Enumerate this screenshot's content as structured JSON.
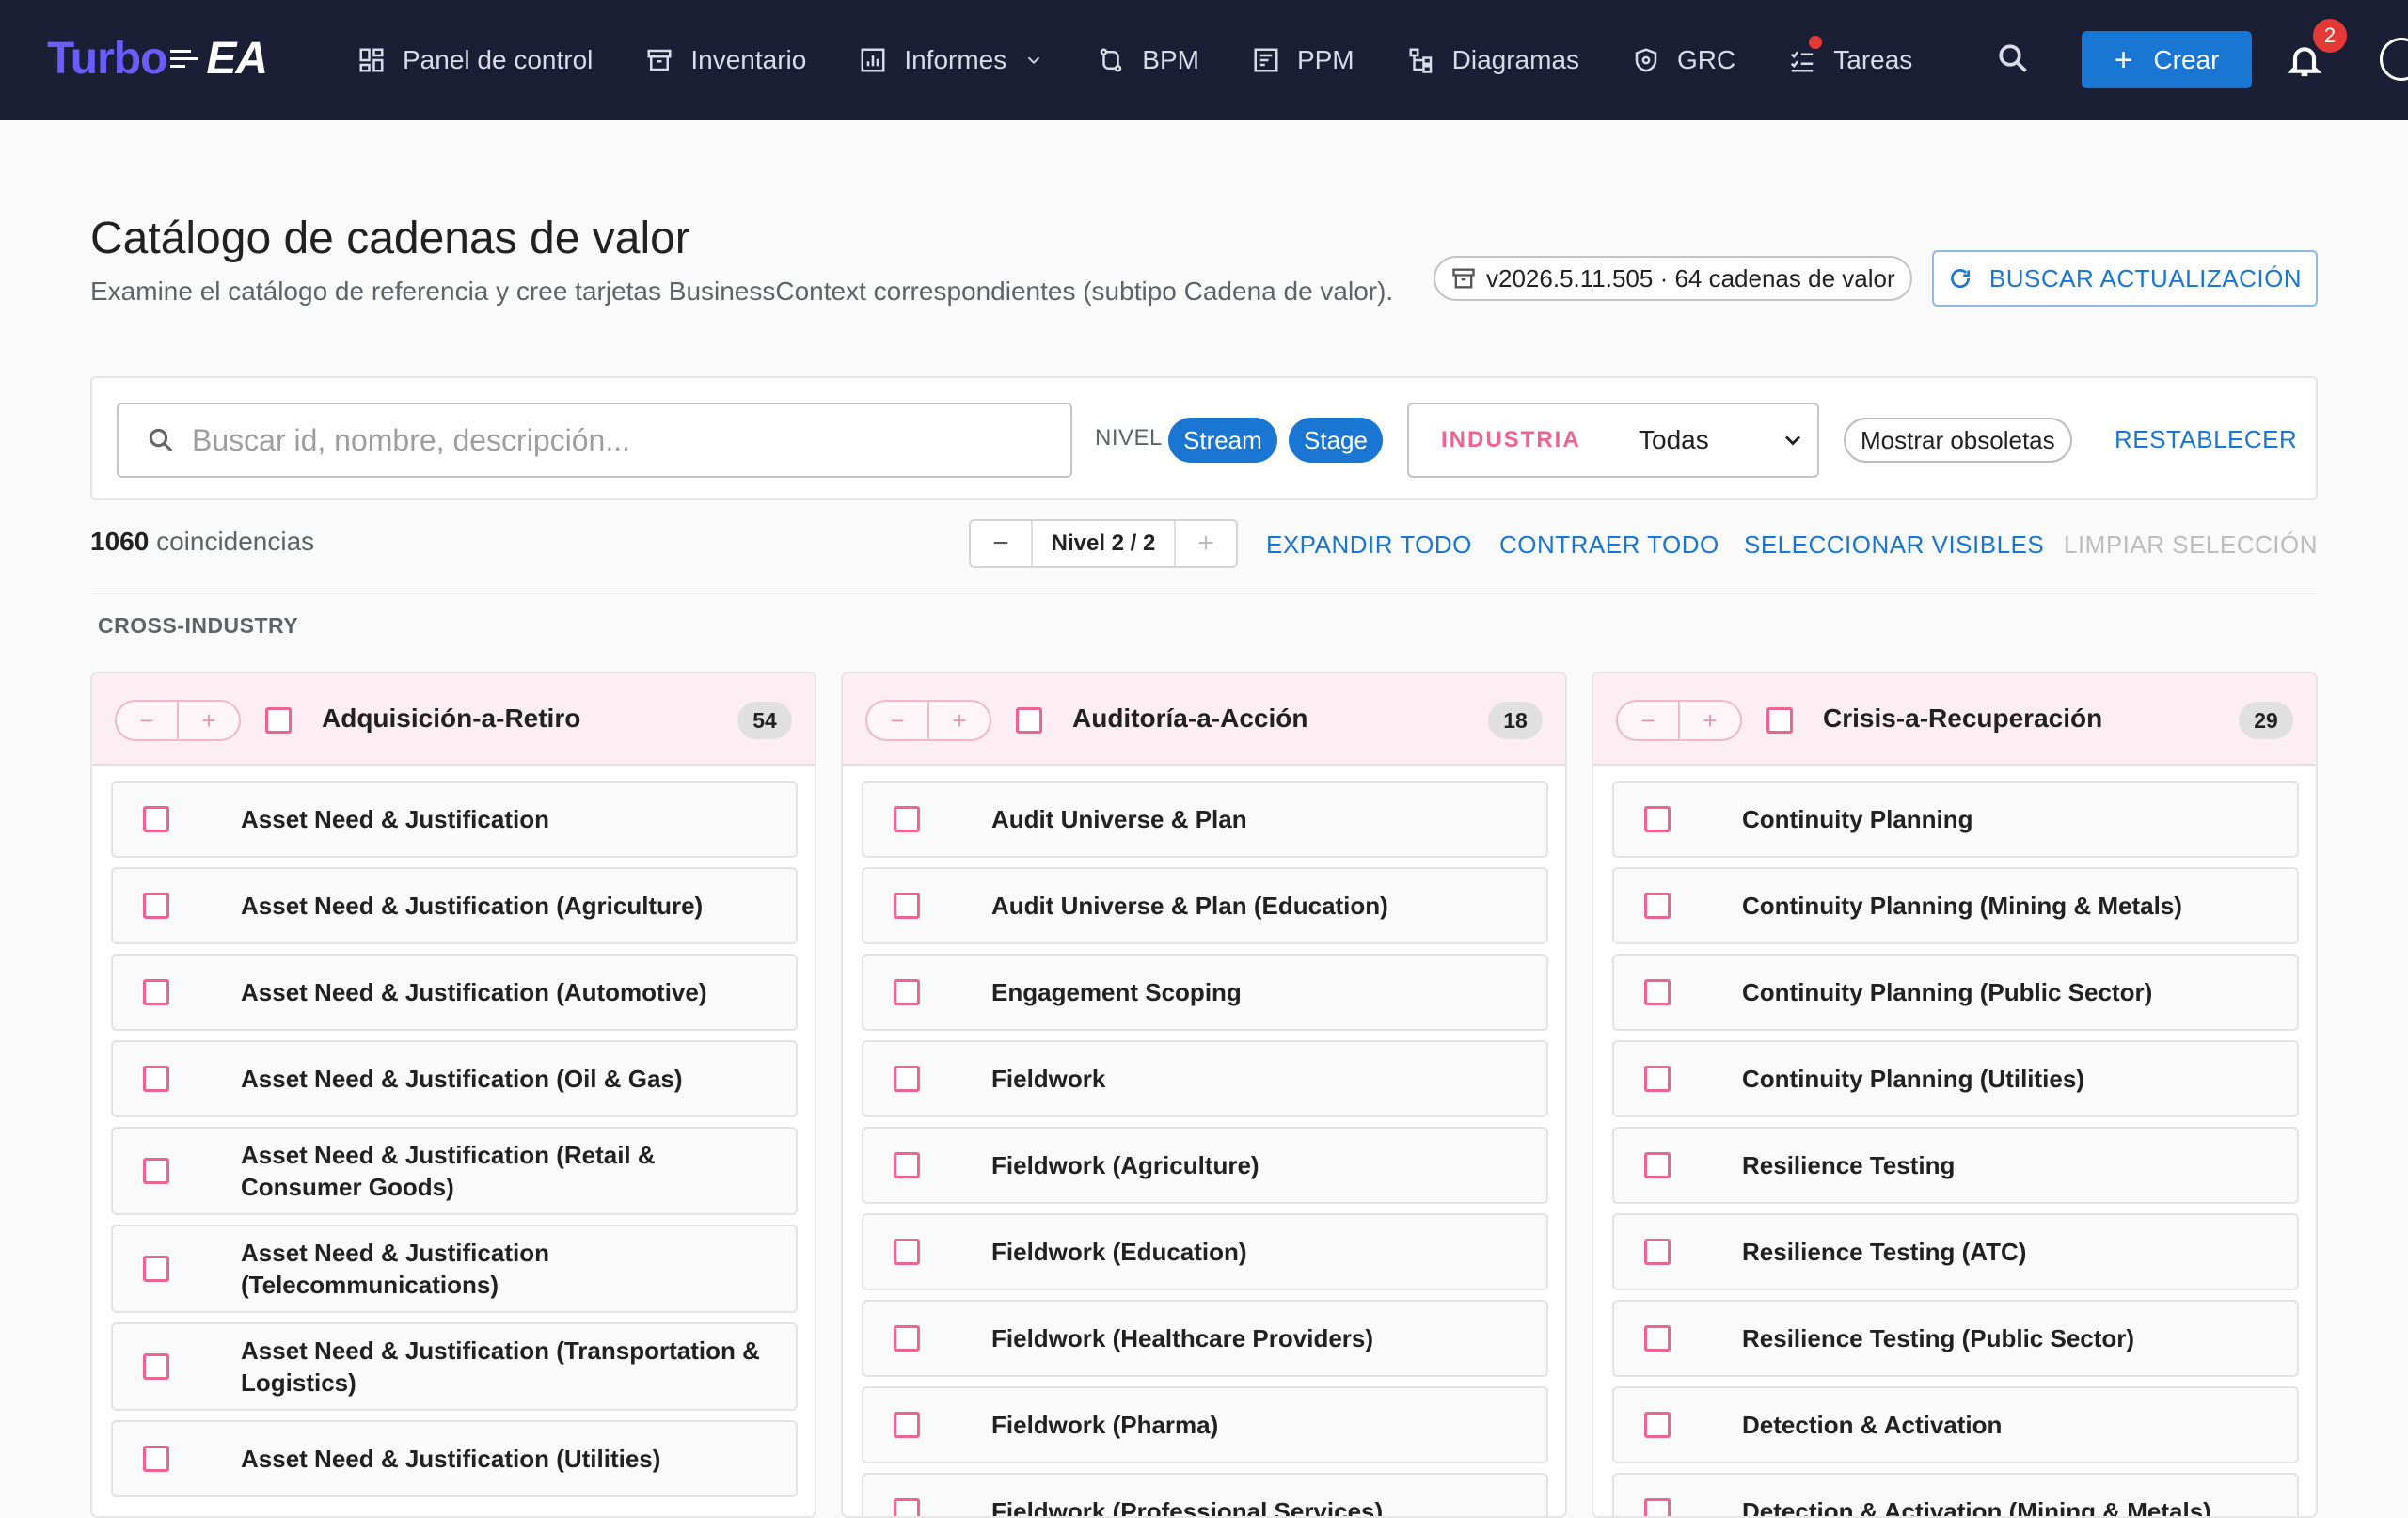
{
  "app": {
    "logo_text": "Turbo",
    "logo_suffix": "EA"
  },
  "nav": [
    {
      "label": "Panel de control",
      "icon": "dashboard-icon"
    },
    {
      "label": "Inventario",
      "icon": "archive-icon"
    },
    {
      "label": "Informes",
      "icon": "report-icon"
    },
    {
      "label": "BPM",
      "icon": "process-icon"
    },
    {
      "label": "PPM",
      "icon": "project-icon"
    },
    {
      "label": "Diagramas",
      "icon": "diagram-icon"
    },
    {
      "label": "GRC",
      "icon": "shield-icon"
    },
    {
      "label": "Tareas",
      "icon": "tasks-icon"
    }
  ],
  "topbar": {
    "create_label": "Crear",
    "notification_count": "2"
  },
  "header": {
    "title": "Catálogo de cadenas de valor",
    "subtitle": "Examine el catálogo de referencia y cree tarjetas BusinessContext correspondientes (subtipo Cadena de valor).",
    "version_chip": "v2026.5.11.505 · 64 cadenas de valor",
    "update_button": "BUSCAR ACTUALIZACIÓN"
  },
  "filters": {
    "search_placeholder": "Buscar id, nombre, descripción...",
    "search_value": "",
    "level_label": "NIVEL",
    "level_chips": [
      "Stream",
      "Stage"
    ],
    "industry_label": "INDUSTRIA",
    "industry_value": "Todas",
    "obsolete_label": "Mostrar obsoletas",
    "reset_label": "RESTABLECER"
  },
  "toolbar": {
    "match_count": "1060",
    "match_suffix": "coincidencias",
    "level_indicator": "Nivel 2 / 2",
    "expand_all": "EXPANDIR TODO",
    "collapse_all": "CONTRAER TODO",
    "select_visible": "SELECCIONAR VISIBLES",
    "clear_selection": "LIMPIAR SELECCIÓN"
  },
  "section_label": "CROSS-INDUSTRY",
  "columns": [
    {
      "title": "Adquisición-a-Retiro",
      "count": "54",
      "items": [
        "Asset Need & Justification",
        "Asset Need & Justification (Agriculture)",
        "Asset Need & Justification (Automotive)",
        "Asset Need & Justification (Oil & Gas)",
        "Asset Need & Justification (Retail & Consumer Goods)",
        "Asset Need & Justification (Telecommunications)",
        "Asset Need & Justification (Transportation & Logistics)",
        "Asset Need & Justification (Utilities)"
      ]
    },
    {
      "title": "Auditoría-a-Acción",
      "count": "18",
      "items": [
        "Audit Universe & Plan",
        "Audit Universe & Plan (Education)",
        "Engagement Scoping",
        "Fieldwork",
        "Fieldwork (Agriculture)",
        "Fieldwork (Education)",
        "Fieldwork (Healthcare Providers)",
        "Fieldwork (Pharma)",
        "Fieldwork (Professional Services)"
      ]
    },
    {
      "title": "Crisis-a-Recuperación",
      "count": "29",
      "items": [
        "Continuity Planning",
        "Continuity Planning (Mining & Metals)",
        "Continuity Planning (Public Sector)",
        "Continuity Planning (Utilities)",
        "Resilience Testing",
        "Resilience Testing (ATC)",
        "Resilience Testing (Public Sector)",
        "Detection & Activation",
        "Detection & Activation (Mining & Metals)"
      ]
    }
  ]
}
